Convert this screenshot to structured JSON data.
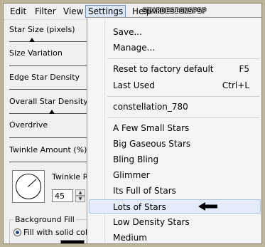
{
  "menubar": {
    "edit": "Edit",
    "filter": "Filter",
    "view": "View",
    "settings": "Settings",
    "help": "Help",
    "watermark": "STARDESIGNSPSP"
  },
  "panel": {
    "star_size": "Star Size (pixels)",
    "size_variation": "Size Variation",
    "edge_density": "Edge Star Density",
    "overall_density": "Overall Star Density",
    "overdrive": "Overdrive",
    "twinkle_amount": "Twinkle Amount (%)",
    "twinkle_rotation": "Twinkle R",
    "twinkle_rotation_value": "45",
    "background_fill": "Background Fill",
    "fill_solid": "Fill with solid color"
  },
  "dropdown": {
    "items": [
      {
        "label": "Save..."
      },
      {
        "label": "Manage..."
      },
      {
        "label": "Reset to factory default",
        "shortcut": "F5"
      },
      {
        "label": "Last Used",
        "shortcut": "Ctrl+L"
      },
      {
        "label": "constellation_780"
      },
      {
        "label": "A Few Small Stars"
      },
      {
        "label": "Big Gaseous Stars"
      },
      {
        "label": "Bling Bling"
      },
      {
        "label": "Glimmer"
      },
      {
        "label": "Its Full of Stars"
      },
      {
        "label": "Lots of Stars"
      },
      {
        "label": "Low Density Stars"
      },
      {
        "label": "Medium"
      }
    ],
    "highlighted": "Lots of Stars"
  },
  "colors": {
    "frame": "#bdb39b",
    "highlight": "#e3ecf8",
    "background_fill_color": "#000000"
  },
  "icons": {
    "pointer": "left-arrow-icon"
  }
}
